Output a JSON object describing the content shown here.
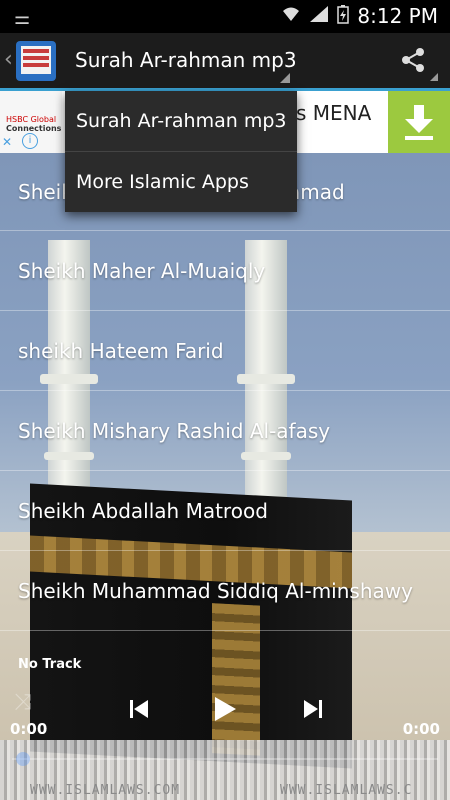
{
  "status_bar": {
    "time": "8:12 PM"
  },
  "action_bar": {
    "title": "Surah Ar-rahman mp3",
    "app_icon_lines": [
      "SURAH",
      "AR-RAHMAN",
      "MP3"
    ]
  },
  "ad": {
    "brand_line1": "HSBC Global",
    "brand_line2": "Connections",
    "text": "s MENA",
    "close_glyph": "✕",
    "info_glyph": "i",
    "accent": "#9cc93f"
  },
  "menu": {
    "items": [
      "Surah Ar-rahman mp3",
      "More Islamic Apps"
    ]
  },
  "reciters": {
    "items": [
      "Sheikh Abdul Basit Abdul Samad",
      "Sheikh Maher Al-Muaiqly",
      "sheikh Hateem Farid",
      "Sheikh Mishary Rashid Al-afasy",
      "Sheikh Abdallah Matrood",
      "Sheikh Muhammad Siddiq Al-minshawy"
    ]
  },
  "player": {
    "track": "No Track",
    "elapsed": "0:00",
    "duration": "0:00",
    "progress": 0
  },
  "watermark": {
    "left": "WWW.ISLAMLAWS.COM",
    "right": "WWW.ISLAMLAWS.C"
  }
}
